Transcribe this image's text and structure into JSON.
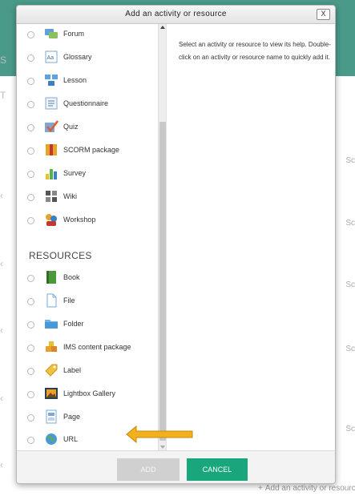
{
  "background": {
    "edge_texts": [
      "Sc",
      "Sc",
      "Sc",
      "Sc",
      "Sc"
    ],
    "left_marks": [
      "S",
      "T",
      "‹",
      "‹",
      "‹",
      "‹",
      "‹"
    ],
    "add_link": "Add an activity or resource"
  },
  "dialog": {
    "title": "Add an activity or resource",
    "close_label": "X",
    "help_text": "Select an activity or resource to view its help. Double-click on an activity or resource name to quickly add it.",
    "activities": [
      {
        "label": "Forum",
        "icon": "forum-icon"
      },
      {
        "label": "Glossary",
        "icon": "glossary-icon"
      },
      {
        "label": "Lesson",
        "icon": "lesson-icon"
      },
      {
        "label": "Questionnaire",
        "icon": "questionnaire-icon"
      },
      {
        "label": "Quiz",
        "icon": "quiz-icon"
      },
      {
        "label": "SCORM package",
        "icon": "scorm-icon"
      },
      {
        "label": "Survey",
        "icon": "survey-icon"
      },
      {
        "label": "Wiki",
        "icon": "wiki-icon"
      },
      {
        "label": "Workshop",
        "icon": "workshop-icon"
      }
    ],
    "resources_header": "RESOURCES",
    "resources": [
      {
        "label": "Book",
        "icon": "book-icon"
      },
      {
        "label": "File",
        "icon": "file-icon"
      },
      {
        "label": "Folder",
        "icon": "folder-icon"
      },
      {
        "label": "IMS content package",
        "icon": "ims-package-icon"
      },
      {
        "label": "Label",
        "icon": "label-icon"
      },
      {
        "label": "Lightbox Gallery",
        "icon": "lightbox-gallery-icon"
      },
      {
        "label": "Page",
        "icon": "page-icon"
      },
      {
        "label": "URL",
        "icon": "url-icon"
      }
    ],
    "add_label": "ADD",
    "cancel_label": "CANCEL"
  },
  "colors": {
    "header_band": "#4a9a8a",
    "cancel_button": "#1aa67c",
    "add_button_disabled": "#d0d0d0",
    "pointer_arrow": "#f2b01e"
  }
}
